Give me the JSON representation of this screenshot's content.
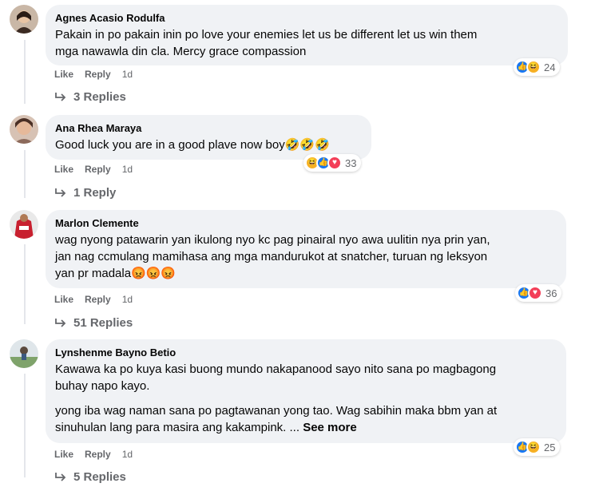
{
  "colors": {
    "bubble": "#f0f2f5",
    "secondary_text": "#65676b",
    "like_blue": "#1877f2",
    "heart_red": "#f33e58",
    "haha_yellow": "#f7b125"
  },
  "comments": [
    {
      "author": "Agnes Acasio Rodulfa",
      "paragraphs": [
        "Pakain in po pakain inin po love your enemies let us be different let us win them\nmga nawawla din cla. Mercy grace compassion"
      ],
      "like_label": "Like",
      "reply_label": "Reply",
      "timestamp": "1d",
      "reaction_icons": [
        "like",
        "haha"
      ],
      "reaction_count": "24",
      "replies_label": "3 Replies"
    },
    {
      "author": "Ana Rhea Maraya",
      "paragraphs": [
        "Good luck you are in a good plave now boy🤣🤣🤣"
      ],
      "like_label": "Like",
      "reply_label": "Reply",
      "timestamp": "1d",
      "reaction_icons": [
        "haha",
        "like",
        "heart"
      ],
      "reaction_count": "33",
      "replies_label": "1 Reply"
    },
    {
      "author": "Marlon Clemente",
      "paragraphs": [
        "wag nyong patawarin yan ikulong nyo kc pag pinairal nyo awa uulitin nya prin yan,\njan nag ccmulang mamihasa ang mga mandurukot at snatcher, turuan ng leksyon\nyan pr madala😡😡😡"
      ],
      "like_label": "Like",
      "reply_label": "Reply",
      "timestamp": "1d",
      "reaction_icons": [
        "like",
        "heart"
      ],
      "reaction_count": "36",
      "replies_label": "51 Replies"
    },
    {
      "author": "Lynshenme Bayno Betio",
      "paragraphs": [
        "Kawawa ka po kuya kasi buong mundo nakapanood sayo nito sana po magbagong\nbuhay napo kayo.",
        "yong iba wag naman sana po pagtawanan yong tao. Wag sabihin maka bbm yan at\nsinuhulan lang para masira ang kakampink. ..."
      ],
      "see_more": "See more",
      "like_label": "Like",
      "reply_label": "Reply",
      "timestamp": "1d",
      "reaction_icons": [
        "like",
        "haha"
      ],
      "reaction_count": "25",
      "replies_label": "5 Replies"
    }
  ]
}
